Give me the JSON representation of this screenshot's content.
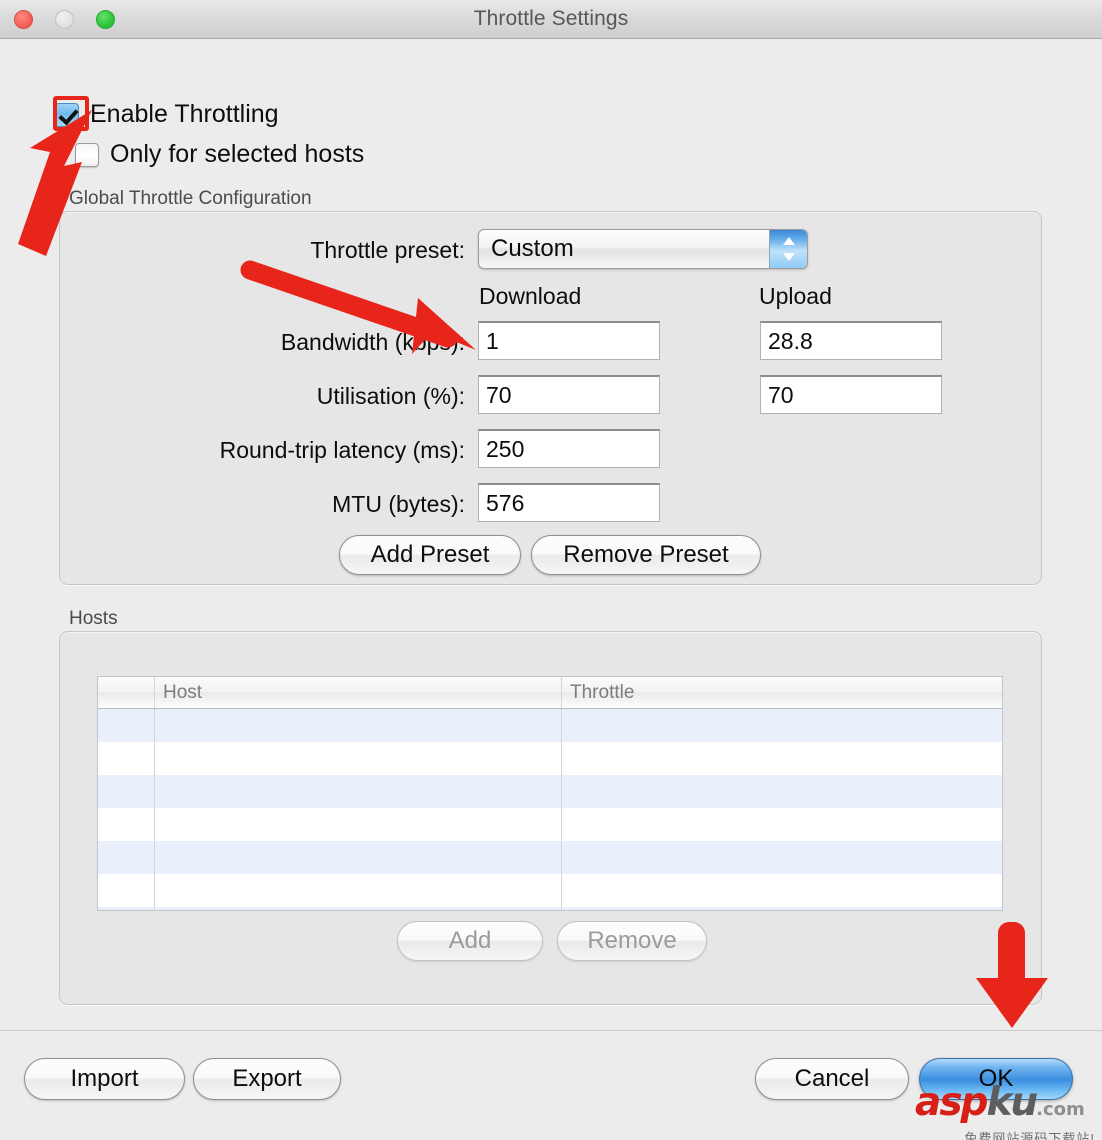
{
  "window": {
    "title": "Throttle Settings",
    "traffic_lights": {
      "close": "close-button",
      "minimize": "minimize-button",
      "maximize": "maximize-button"
    }
  },
  "options": {
    "enable_throttling": {
      "label": "Enable Throttling",
      "checked": true
    },
    "only_selected_hosts": {
      "label": "Only for selected hosts",
      "checked": false
    }
  },
  "global_group": {
    "title": "Global Throttle Configuration",
    "preset_label": "Throttle preset:",
    "preset_value": "Custom",
    "column_headers": {
      "download": "Download",
      "upload": "Upload"
    },
    "rows": [
      {
        "label": "Bandwidth (kbps):",
        "download": "1",
        "upload": "28.8",
        "has_upload": true
      },
      {
        "label": "Utilisation (%):",
        "download": "70",
        "upload": "70",
        "has_upload": true
      },
      {
        "label": "Round-trip latency (ms):",
        "download": "250",
        "upload": "",
        "has_upload": false
      },
      {
        "label": "MTU (bytes):",
        "download": "576",
        "upload": "",
        "has_upload": false
      }
    ],
    "add_preset_label": "Add Preset",
    "remove_preset_label": "Remove Preset"
  },
  "hosts_group": {
    "title": "Hosts",
    "columns": [
      "",
      "Host",
      "Throttle"
    ],
    "rows": [],
    "row_count": 7,
    "add_label": "Add",
    "remove_label": "Remove",
    "add_enabled": false,
    "remove_enabled": false
  },
  "footer": {
    "import_label": "Import",
    "export_label": "Export",
    "cancel_label": "Cancel",
    "ok_label": "OK"
  },
  "annotations": {
    "color": "#e8251b",
    "arrow_to_enable_throttling": "arrow-up-right",
    "arrow_to_bandwidth_download": "arrow-down-right",
    "arrow_to_ok_button": "arrow-down",
    "highlight_box_target": "enable-throttling-checkbox"
  },
  "watermark": {
    "brand_part1": "asp",
    "brand_part2": "ku",
    "domain": ".com",
    "subtitle": "免费网站源码下载站!"
  }
}
